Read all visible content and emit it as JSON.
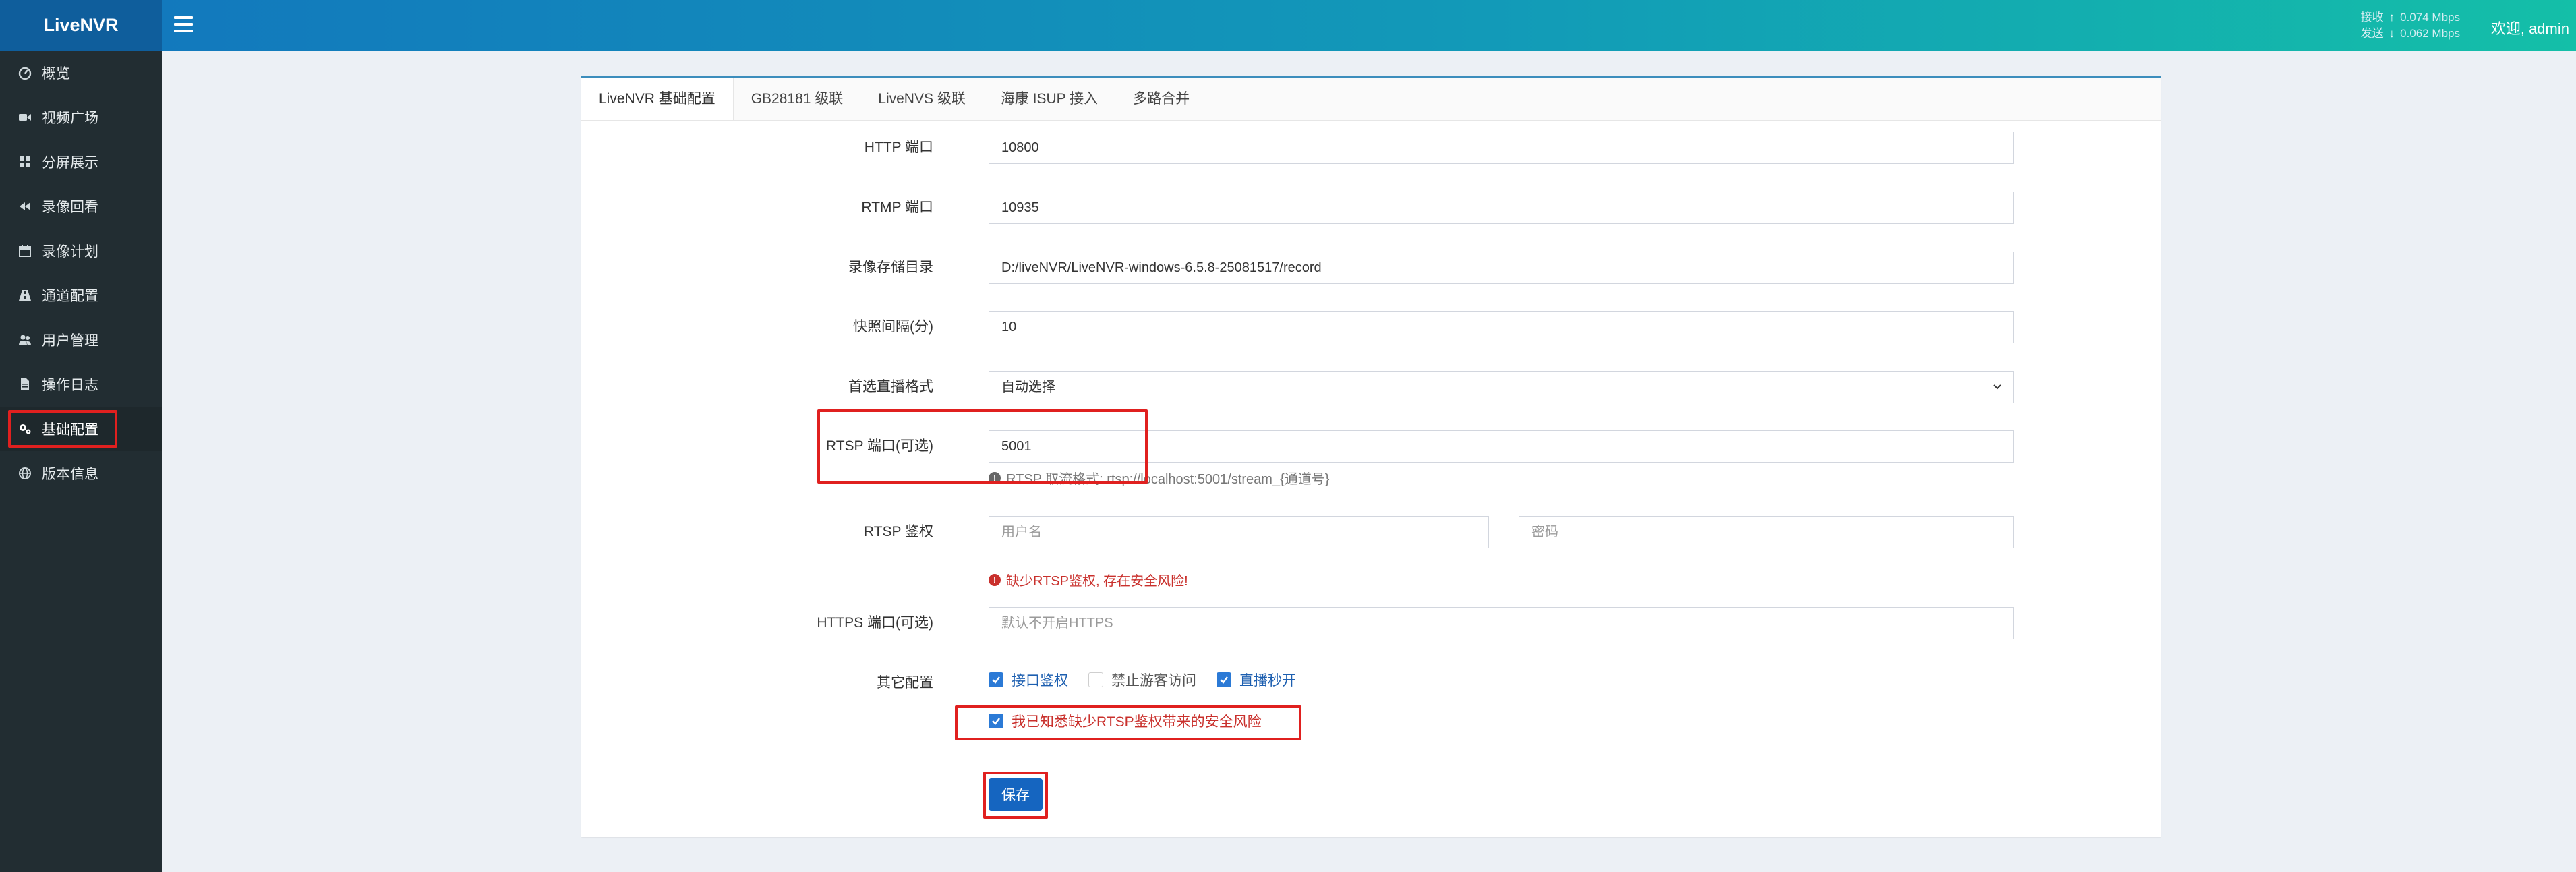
{
  "app": {
    "title": "LiveNVR"
  },
  "header": {
    "receive_label": "接收",
    "receive_rate": "0.074 Mbps",
    "send_label": "发送",
    "send_rate": "0.062 Mbps",
    "welcome": "欢迎, admin"
  },
  "sidebar": {
    "items": [
      {
        "label": "概览",
        "icon": "dashboard-icon"
      },
      {
        "label": "视频广场",
        "icon": "video-camera-icon"
      },
      {
        "label": "分屏展示",
        "icon": "grid-icon"
      },
      {
        "label": "录像回看",
        "icon": "rewind-icon"
      },
      {
        "label": "录像计划",
        "icon": "calendar-icon"
      },
      {
        "label": "通道配置",
        "icon": "road-icon"
      },
      {
        "label": "用户管理",
        "icon": "users-icon"
      },
      {
        "label": "操作日志",
        "icon": "file-icon"
      },
      {
        "label": "基础配置",
        "icon": "gears-icon"
      },
      {
        "label": "版本信息",
        "icon": "globe-icon"
      }
    ],
    "active_index": 8
  },
  "tabs": [
    "LiveNVR 基础配置",
    "GB28181 级联",
    "LiveNVS 级联",
    "海康 ISUP 接入",
    "多路合并"
  ],
  "form": {
    "http_port": {
      "label": "HTTP 端口",
      "value": "10800"
    },
    "rtmp_port": {
      "label": "RTMP 端口",
      "value": "10935"
    },
    "record_dir": {
      "label": "录像存储目录",
      "value": "D:/liveNVR/LiveNVR-windows-6.5.8-25081517/record"
    },
    "snapshot_interval": {
      "label": "快照间隔(分)",
      "value": "10"
    },
    "preferred_format": {
      "label": "首选直播格式",
      "value": "自动选择"
    },
    "rtsp_port": {
      "label": "RTSP 端口(可选)",
      "value": "5001",
      "help": "RTSP 取流格式: rtsp://localhost:5001/stream_{通道号}"
    },
    "rtsp_auth": {
      "label": "RTSP 鉴权",
      "username_placeholder": "用户名",
      "password_placeholder": "密码",
      "warning": "缺少RTSP鉴权, 存在安全风险!"
    },
    "https_port": {
      "label": "HTTPS 端口(可选)",
      "placeholder": "默认不开启HTTPS"
    },
    "other": {
      "label": "其它配置",
      "api_auth": "接口鉴权",
      "no_guest": "禁止游客访问",
      "instant_live": "直播秒开",
      "ack_risk": "我已知悉缺少RTSP鉴权带来的安全风险"
    },
    "save_label": "保存"
  },
  "colors": {
    "brand": "#0f5e9c",
    "sidebar": "#222d32",
    "accent": "#2b7ad6",
    "danger": "#c9302c",
    "highlight": "#e0201f"
  }
}
